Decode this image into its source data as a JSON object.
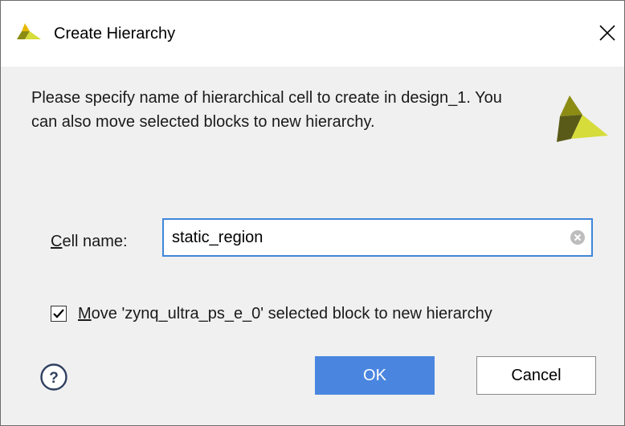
{
  "window": {
    "title": "Create Hierarchy",
    "app_icon": "xilinx-logo-icon",
    "close_icon": "close-icon"
  },
  "description": "Please specify name of hierarchical cell to create in design_1. You can also move selected blocks to new hierarchy.",
  "brand_logo": "xilinx-logo-icon",
  "cell_name": {
    "label_mnemonic": "C",
    "label_rest": "ell name:",
    "value": "static_region",
    "clear_icon": "clear-icon"
  },
  "move_option": {
    "checked": true,
    "label_mnemonic": "M",
    "label_rest": "ove 'zynq_ultra_ps_e_0' selected block to new hierarchy"
  },
  "buttons": {
    "help_icon": "help-icon",
    "help_glyph": "?",
    "ok_label": "OK",
    "cancel_label": "Cancel"
  },
  "colors": {
    "accent": "#4a86e0",
    "focus_border": "#3f86d9",
    "logo_dark": "#5a5a18",
    "logo_light": "#d6dc3a"
  }
}
